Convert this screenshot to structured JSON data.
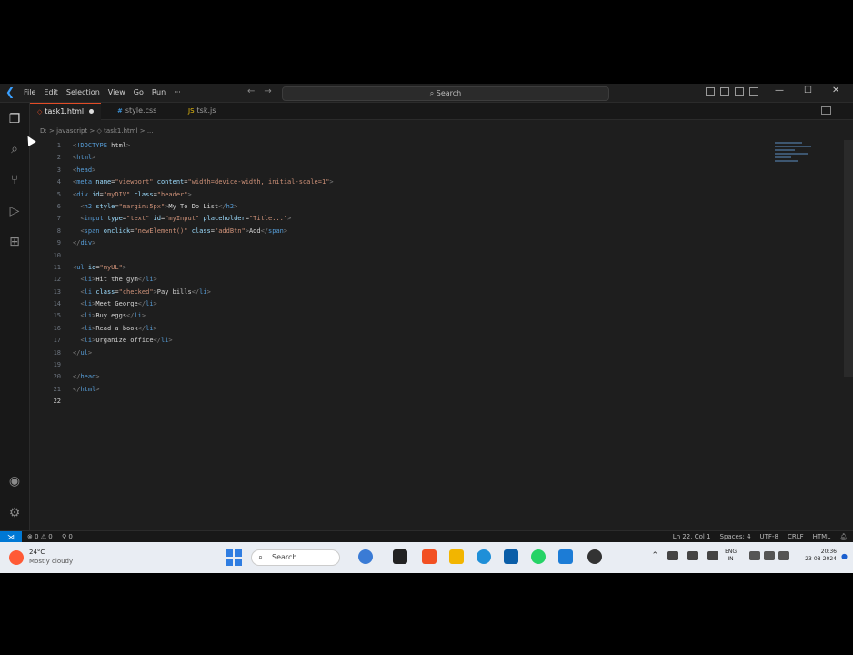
{
  "titlebar": {
    "menu": [
      "File",
      "Edit",
      "Selection",
      "View",
      "Go",
      "Run",
      "···"
    ],
    "search_placeholder": "Search"
  },
  "tabs": [
    {
      "label": "task1.html",
      "modified": true,
      "active": true
    },
    {
      "label": "style.css",
      "modified": false,
      "active": false
    },
    {
      "label": "tsk.js",
      "modified": false,
      "active": false
    }
  ],
  "breadcrumb": "D: > javascript > ◇ task1.html > ...",
  "editor": {
    "current_line": 22,
    "line_numbers": [
      "1",
      "2",
      "3",
      "4",
      "5",
      "6",
      "7",
      "8",
      "9",
      "10",
      "11",
      "12",
      "13",
      "14",
      "15",
      "16",
      "17",
      "18",
      "19",
      "20",
      "21",
      "22"
    ],
    "code": [
      "<!DOCTYPE html>",
      "<html>",
      "<head>",
      "<meta name=\"viewport\" content=\"width=device-width, initial-scale=1\">",
      "<div id=\"myDIV\" class=\"header\">",
      "  <h2 style=\"margin:5px\">My To Do List</h2>",
      "  <input type=\"text\" id=\"myInput\" placeholder=\"Title...\">",
      "  <span onclick=\"newElement()\" class=\"addBtn\">Add</span>",
      "</div>",
      "",
      "<ul id=\"myUL\">",
      "  <li>Hit the gym</li>",
      "  <li class=\"checked\">Pay bills</li>",
      "  <li>Meet George</li>",
      "  <li>Buy eggs</li>",
      "  <li>Read a book</li>",
      "  <li>Organize office</li>",
      "</ul>",
      "",
      "</head>",
      "</html>",
      ""
    ]
  },
  "statusbar": {
    "remote": "⋊",
    "problems": "⊗ 0 ⚠ 0",
    "ports": "⚲ 0",
    "position": "Ln 22, Col 1",
    "spaces": "Spaces: 4",
    "encoding": "UTF-8",
    "eol": "CRLF",
    "language": "HTML"
  },
  "taskbar": {
    "weather_temp": "24°C",
    "weather_desc": "Mostly cloudy",
    "search_label": "Search",
    "language": "ENG",
    "language_region": "IN",
    "time": "20:36",
    "date": "23-08-2024"
  },
  "colors": {
    "accent": "#0078d4",
    "tag": "#569cd6",
    "attribute": "#9cdcfe",
    "string": "#ce9178"
  }
}
